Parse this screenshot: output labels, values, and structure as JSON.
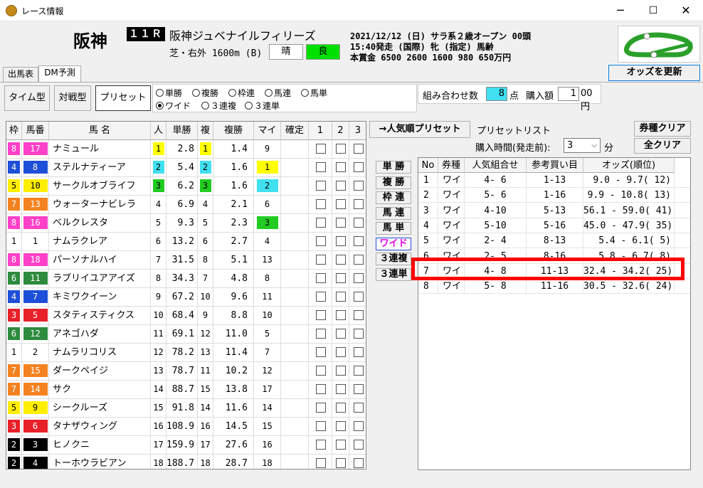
{
  "window": {
    "title": "レース情報",
    "min": "─",
    "max": "☐",
    "close": "✕"
  },
  "race": {
    "venue": "阪神",
    "number": "１１Ｒ",
    "name": "阪神ジュベナイルフィリーズ",
    "course": "芝・右外 1600m (B)",
    "weather": "晴",
    "going": "良",
    "info1": "2021/12/12 (日) サラ系２歳オープン 00頭",
    "info2": "15:40発走 (国際) 牝 (指定) 馬齢",
    "info3": "本賞金 6500 2600 1600 980 650万円"
  },
  "buttons": {
    "odds_update": "オッズを更新",
    "time_type": "タイム型",
    "battle_type": "対戦型",
    "preset": "プリセット",
    "popular_preset": "→人気順プリセット",
    "type_clear": "券種クリア",
    "all_clear": "全クリア"
  },
  "tabs": [
    {
      "label": "出馬表"
    },
    {
      "label": "DM予測"
    }
  ],
  "bet_radios": [
    {
      "label": "単勝",
      "checked": false
    },
    {
      "label": "複勝",
      "checked": false
    },
    {
      "label": "枠連",
      "checked": false
    },
    {
      "label": "馬連",
      "checked": false
    },
    {
      "label": "馬単",
      "checked": false
    },
    {
      "label": "ワイド",
      "checked": true
    },
    {
      "label": "３連複",
      "checked": false
    },
    {
      "label": "３連単",
      "checked": false
    }
  ],
  "combo": {
    "label": "組み合わせ数",
    "count": "8",
    "unit": "点",
    "amount_label": "購入額",
    "amount": "1",
    "amount_unit": "00円"
  },
  "grid": {
    "headers": [
      "枠",
      "馬番",
      "馬 名",
      "人",
      "単勝",
      "複",
      "複勝",
      "マイ",
      "確定",
      "1",
      "2",
      "3"
    ],
    "rows": [
      {
        "waku": "8",
        "ban": "17",
        "name": "ナミュール",
        "pop": "1",
        "win": "2.8",
        "fuku": "1",
        "place": "1.4",
        "my": "9"
      },
      {
        "waku": "4",
        "ban": "8",
        "name": "ステルナティーア",
        "pop": "2",
        "win": "5.4",
        "fuku": "2",
        "place": "1.6",
        "my": "1"
      },
      {
        "waku": "5",
        "ban": "10",
        "name": "サークルオブライフ",
        "pop": "3",
        "win": "6.2",
        "fuku": "3",
        "place": "1.6",
        "my": "2"
      },
      {
        "waku": "7",
        "ban": "13",
        "name": "ウォーターナビレラ",
        "pop": "4",
        "win": "6.9",
        "fuku": "4",
        "place": "2.1",
        "my": "6"
      },
      {
        "waku": "8",
        "ban": "16",
        "name": "ベルクレスタ",
        "pop": "5",
        "win": "9.3",
        "fuku": "5",
        "place": "2.3",
        "my": "3"
      },
      {
        "waku": "1",
        "ban": "1",
        "name": "ナムラクレア",
        "pop": "6",
        "win": "13.2",
        "fuku": "6",
        "place": "2.7",
        "my": "4"
      },
      {
        "waku": "8",
        "ban": "18",
        "name": "パーソナルハイ",
        "pop": "7",
        "win": "31.5",
        "fuku": "8",
        "place": "5.1",
        "my": "13"
      },
      {
        "waku": "6",
        "ban": "11",
        "name": "ラブリイユアアイズ",
        "pop": "8",
        "win": "34.3",
        "fuku": "7",
        "place": "4.8",
        "my": "8"
      },
      {
        "waku": "4",
        "ban": "7",
        "name": "キミワクイーン",
        "pop": "9",
        "win": "67.2",
        "fuku": "10",
        "place": "9.6",
        "my": "11"
      },
      {
        "waku": "3",
        "ban": "5",
        "name": "スタティスティクス",
        "pop": "10",
        "win": "68.4",
        "fuku": "9",
        "place": "8.8",
        "my": "10"
      },
      {
        "waku": "6",
        "ban": "12",
        "name": "アネゴハダ",
        "pop": "11",
        "win": "69.1",
        "fuku": "12",
        "place": "11.0",
        "my": "5"
      },
      {
        "waku": "1",
        "ban": "2",
        "name": "ナムラリコリス",
        "pop": "12",
        "win": "78.2",
        "fuku": "13",
        "place": "11.4",
        "my": "7"
      },
      {
        "waku": "7",
        "ban": "15",
        "name": "ダークペイジ",
        "pop": "13",
        "win": "78.7",
        "fuku": "11",
        "place": "10.2",
        "my": "12"
      },
      {
        "waku": "7",
        "ban": "14",
        "name": "サク",
        "pop": "14",
        "win": "88.7",
        "fuku": "15",
        "place": "13.8",
        "my": "17"
      },
      {
        "waku": "5",
        "ban": "9",
        "name": "シークルーズ",
        "pop": "15",
        "win": "91.8",
        "fuku": "14",
        "place": "11.6",
        "my": "14"
      },
      {
        "waku": "3",
        "ban": "6",
        "name": "タナザウィング",
        "pop": "16",
        "win": "108.9",
        "fuku": "16",
        "place": "14.5",
        "my": "15"
      },
      {
        "waku": "2",
        "ban": "3",
        "name": "ヒノクニ",
        "pop": "17",
        "win": "159.9",
        "fuku": "17",
        "place": "27.6",
        "my": "16"
      },
      {
        "waku": "2",
        "ban": "4",
        "name": "トーホウラビアン",
        "pop": "18",
        "win": "188.7",
        "fuku": "18",
        "place": "28.7",
        "my": "18"
      }
    ]
  },
  "preset": {
    "title": "プリセットリスト",
    "buy_time_label": "購入時間(発走前):",
    "buy_time": "3",
    "buy_time_unit": "分",
    "type_buttons": [
      "単 勝",
      "複 勝",
      "枠 連",
      "馬 連",
      "馬 単",
      "ワイド",
      "３連複",
      "３連単"
    ],
    "headers": [
      "No",
      "券種",
      "人気組合せ",
      "参考買い目",
      "オッズ(順位)"
    ],
    "rows": [
      {
        "no": "1",
        "type": "ワイ",
        "combo": "4- 6",
        "ref": "1-13",
        "odds": "9.0 - 9.7( 12)"
      },
      {
        "no": "2",
        "type": "ワイ",
        "combo": "5- 6",
        "ref": "1-16",
        "odds": "9.9 - 10.8( 13)"
      },
      {
        "no": "3",
        "type": "ワイ",
        "combo": "4-10",
        "ref": "5-13",
        "odds": "56.1 - 59.0( 41)"
      },
      {
        "no": "4",
        "type": "ワイ",
        "combo": "5-10",
        "ref": "5-16",
        "odds": "45.0 - 47.9( 35)"
      },
      {
        "no": "5",
        "type": "ワイ",
        "combo": "2- 4",
        "ref": "8-13",
        "odds": "5.4 - 6.1( 5)"
      },
      {
        "no": "6",
        "type": "ワイ",
        "combo": "2- 5",
        "ref": "8-16",
        "odds": "5.8 - 6.7( 8)"
      },
      {
        "no": "7",
        "type": "ワイ",
        "combo": "4- 8",
        "ref": "11-13",
        "odds": "32.4 - 34.2( 25)"
      },
      {
        "no": "8",
        "type": "ワイ",
        "combo": "5- 8",
        "ref": "11-16",
        "odds": "30.5 - 32.6( 24)"
      }
    ]
  },
  "colors": {
    "waku": {
      "1": "#ffffff",
      "2": "#000000",
      "3": "#e8202a",
      "4": "#1d4fd8",
      "5": "#ffee00",
      "6": "#2e8b3e",
      "7": "#f58220",
      "8": "#ff40c8"
    },
    "pop1": "#ffff00",
    "pop2": "#40e0f0",
    "pop3": "#22cc22",
    "highlight": "#ff0000"
  }
}
